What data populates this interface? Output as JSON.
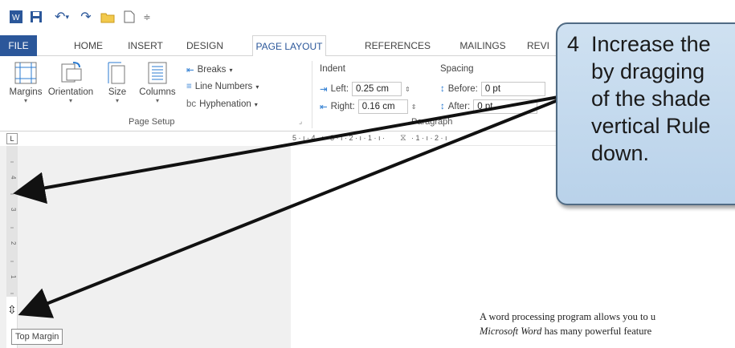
{
  "qat": {
    "word_icon": "word-icon",
    "save_icon": "save-icon",
    "undo_icon": "undo-icon",
    "redo_icon": "redo-icon",
    "open_icon": "open-folder-icon",
    "new_icon": "new-document-icon",
    "customize_icon": "customize-qat-icon"
  },
  "tabs": [
    "FILE",
    "HOME",
    "INSERT",
    "DESIGN",
    "PAGE LAYOUT",
    "REFERENCES",
    "MAILINGS",
    "REVI"
  ],
  "ribbon": {
    "page_setup": {
      "margins": "Margins",
      "orientation": "Orientation",
      "size": "Size",
      "columns": "Columns",
      "breaks": "Breaks",
      "line_numbers": "Line Numbers",
      "hyphenation": "Hyphenation",
      "label": "Page Setup"
    },
    "paragraph": {
      "indent_label": "Indent",
      "left_label": "Left:",
      "left_value": "0.25 cm",
      "right_label": "Right:",
      "right_value": "0.16 cm",
      "spacing_label": "Spacing",
      "before_label": "Before:",
      "before_value": "0 pt",
      "after_label": "After:",
      "after_value": "0 pt",
      "label": "Paragraph"
    }
  },
  "ruler": {
    "corner": "L",
    "horizontal_ticks": "5 · ı · 4 · ı · 3 · ı · 2 · ı · 1 · ı ·",
    "horizontal_ticks_right": "· 1 · ı · 2 · ı"
  },
  "document": {
    "line1": "A word processing program allows you to u",
    "line2_italic": "Microsoft Word",
    "line2_rest": " has many powerful feature"
  },
  "tooltip": "Top Margin",
  "callout": {
    "text": "4  Increase the\n    by dragging\n    of the shade\n    vertical Rule\n    down."
  }
}
